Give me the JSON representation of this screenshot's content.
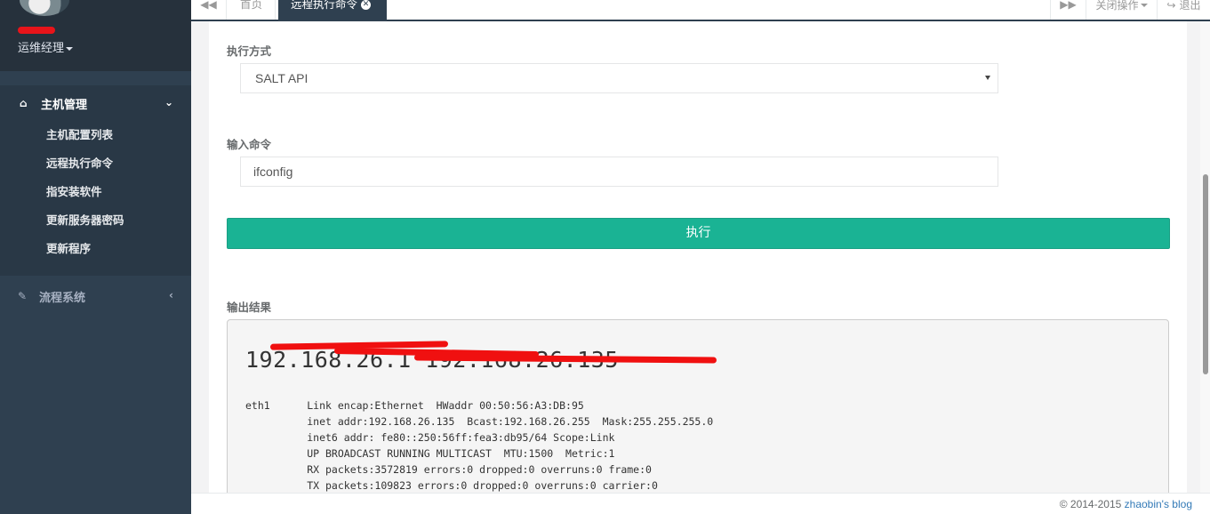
{
  "sidebar": {
    "user_role": "运维经理",
    "groups": [
      {
        "label": "主机管理",
        "icon": "home-icon",
        "items": [
          {
            "label": "主机配置列表"
          },
          {
            "label": "远程执行命令"
          },
          {
            "label": "指安装软件"
          },
          {
            "label": "更新服务器密码"
          },
          {
            "label": "更新程序"
          }
        ]
      },
      {
        "label": "流程系统",
        "icon": "edit-icon"
      }
    ]
  },
  "tabs": {
    "home": "首页",
    "active": "远程执行命令",
    "close_ops": "关闭操作",
    "logout": "退出"
  },
  "form": {
    "method_label": "执行方式",
    "method_value": "SALT API",
    "command_label": "输入命令",
    "command_value": "ifconfig",
    "run_button": "执行",
    "output_label": "输出结果"
  },
  "output": {
    "host": "192.168.26.1 192.168.26.135",
    "lines": "eth1      Link encap:Ethernet  HWaddr 00:50:56:A3:DB:95\n          inet addr:192.168.26.135  Bcast:192.168.26.255  Mask:255.255.255.0\n          inet6 addr: fe80::250:56ff:fea3:db95/64 Scope:Link\n          UP BROADCAST RUNNING MULTICAST  MTU:1500  Metric:1\n          RX packets:3572819 errors:0 dropped:0 overruns:0 frame:0\n          TX packets:109823 errors:0 dropped:0 overruns:0 carrier:0"
  },
  "footer": {
    "copyright": "© 2014-2015",
    "blog": "zhaobin's blog"
  },
  "colors": {
    "sidebar": "#2f4050",
    "accent": "#1ab394",
    "redaction": "#f01010"
  }
}
